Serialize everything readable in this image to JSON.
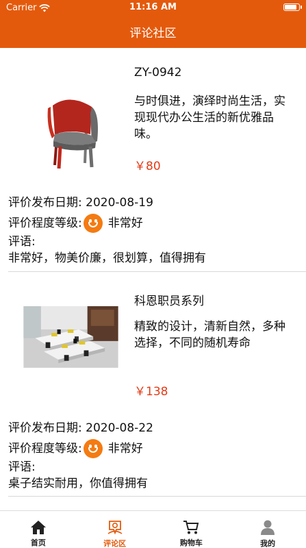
{
  "status_bar": {
    "carrier": "Carrier",
    "time": "11:16 AM"
  },
  "nav": {
    "title": "评论社区"
  },
  "reviews": [
    {
      "product_name": "ZY-0942",
      "description": "与时俱进，演绎时尚生活，实现现代办公生活的新优雅品味。",
      "price": "￥80",
      "date_label": "评价发布日期: 2020-08-19",
      "rating_label": "评价程度等级:",
      "rating_text": "非常好",
      "comment_label": "评语:",
      "comment": "非常好，物美价廉，很划算，值得拥有",
      "image_icon": "chair-image"
    },
    {
      "product_name": "科恩职员系列",
      "description": "精致的设计，清新自然，多种选择，不同的随机寿命",
      "price": "￥138",
      "date_label": "评价发布日期: 2020-08-22",
      "rating_label": "评价程度等级:",
      "rating_text": "非常好",
      "comment_label": "评语:",
      "comment": "桌子结实耐用，你值得拥有",
      "image_icon": "office-desks-image"
    }
  ],
  "tabbar": {
    "items": [
      {
        "label": "首页",
        "icon": "home-icon",
        "active": false
      },
      {
        "label": "评论区",
        "icon": "review-icon",
        "active": true
      },
      {
        "label": "购物车",
        "icon": "cart-icon",
        "active": false
      },
      {
        "label": "我的",
        "icon": "user-icon",
        "active": false
      }
    ]
  },
  "colors": {
    "accent": "#e45a0c",
    "price": "#e23b16",
    "smile": "#f47b12"
  }
}
